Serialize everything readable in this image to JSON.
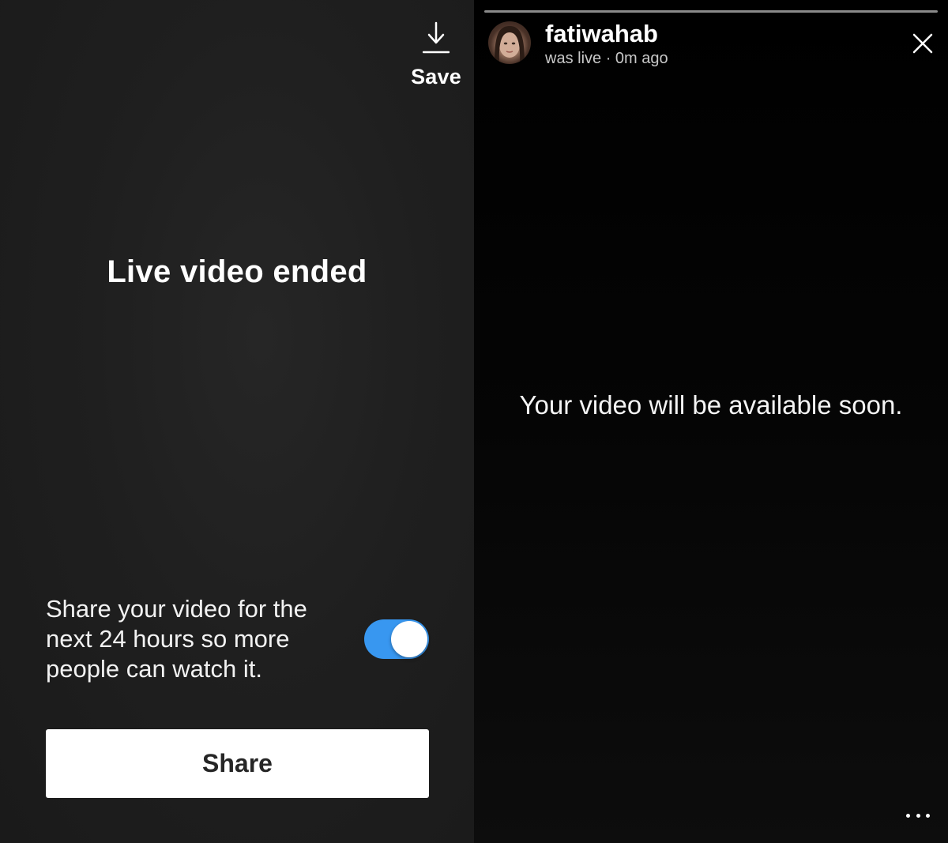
{
  "left_panel": {
    "save_label": "Save",
    "ended_title": "Live video ended",
    "share_description": "Share your video for the next 24 hours so more people can watch it.",
    "share_toggle_on": true,
    "share_button_label": "Share"
  },
  "right_panel": {
    "username": "fatiwahab",
    "live_status": "was live · 0m ago",
    "message": "Your video will be available soon."
  },
  "colors": {
    "toggle_on": "#3897f0",
    "button_bg": "#ffffff",
    "button_text": "#262626"
  },
  "icons": {
    "save": "download-arrow-icon",
    "close": "close-icon",
    "more": "more-dots-icon"
  }
}
